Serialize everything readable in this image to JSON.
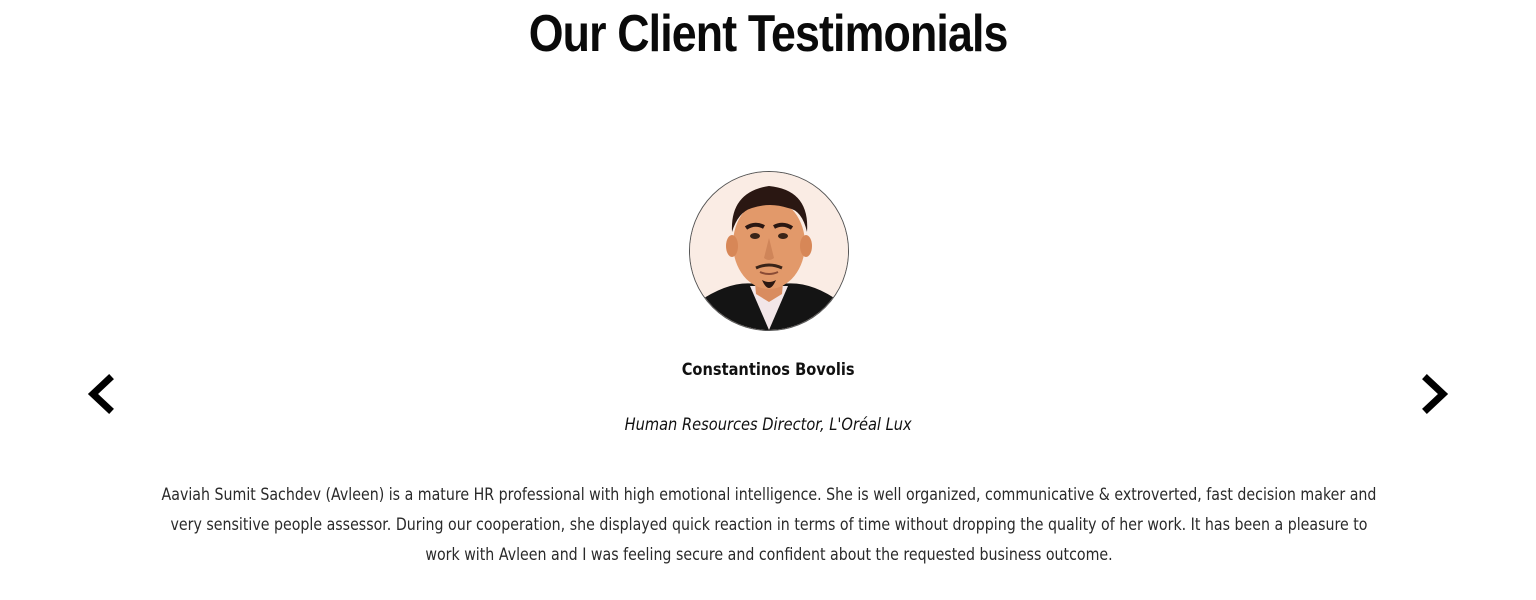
{
  "section": {
    "title": "Our Client Testimonials"
  },
  "testimonial": {
    "avatar_icon": "person-portrait",
    "name": "Constantinos Bovolis",
    "role": "Human Resources Director, L'Oréal Lux",
    "quote": "Aaviah Sumit Sachdev (Avleen) is a mature HR professional with high emotional intelligence. She is well organized, communicative & extroverted, fast decision maker and very sensitive people assessor. During our cooperation, she displayed quick reaction in terms of time without dropping the quality of her work. It has been a pleasure to work with Avleen and I was feeling secure and confident about the requested business outcome."
  },
  "carousel": {
    "prev_icon": "chevron-left-icon",
    "next_icon": "chevron-right-icon"
  }
}
